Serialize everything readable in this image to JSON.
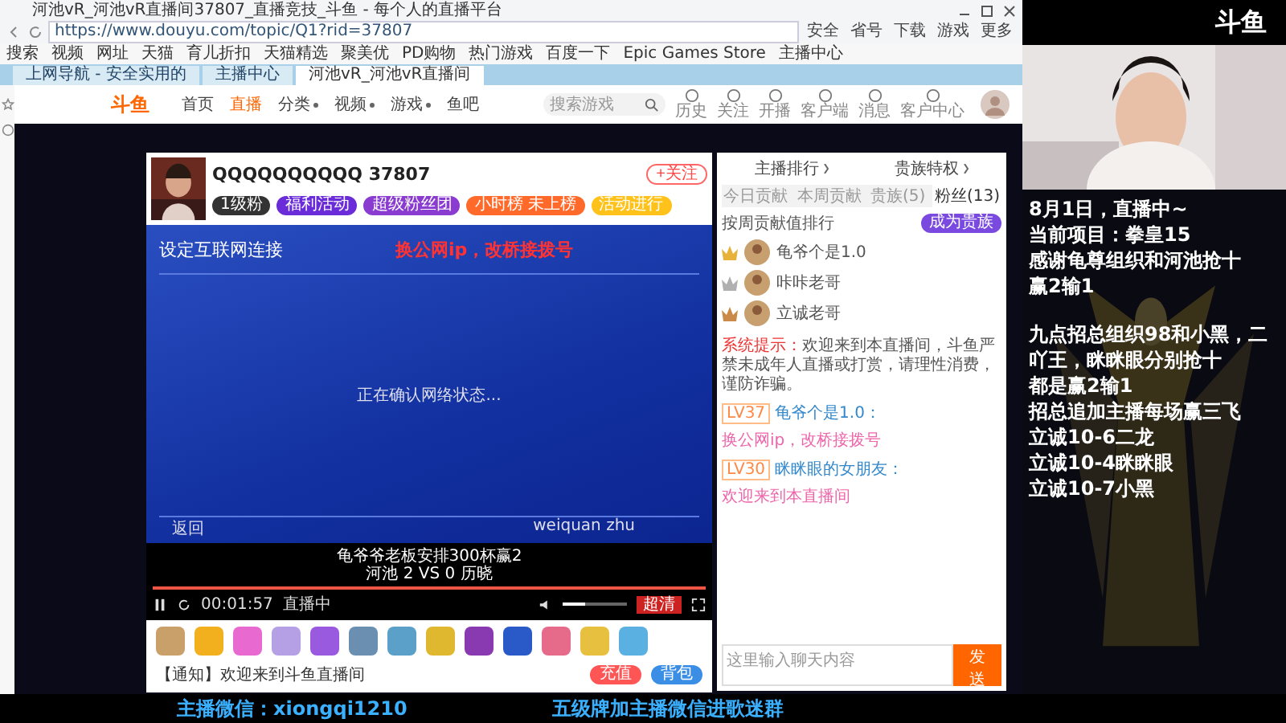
{
  "browser": {
    "title": "河池vR_河池vR直播间37807_直播竞技_斗鱼 - 每个人的直播平台",
    "url": "https://www.douyu.com/topic/Q1?rid=37807",
    "toolbar_buttons": [
      "安全",
      "省号",
      "下载",
      "游戏",
      "更多"
    ],
    "bookmarks": [
      "搜索",
      "视频",
      "网址",
      "天猫",
      "育儿折扣",
      "天猫精选",
      "聚美优",
      "PD购物",
      "热门游戏",
      "百度一下",
      "Epic Games Store",
      "主播中心"
    ],
    "tabs": [
      {
        "label": "上网导航 - 安全实用的",
        "selected": false
      },
      {
        "label": "主播中心",
        "selected": false
      },
      {
        "label": "河池vR_河池vR直播间",
        "selected": true
      }
    ]
  },
  "site_nav": {
    "logo": "斗鱼",
    "items": [
      {
        "label": "首页",
        "selected": false,
        "dropdown": false
      },
      {
        "label": "直播",
        "selected": true,
        "dropdown": false
      },
      {
        "label": "分类",
        "selected": false,
        "dropdown": true
      },
      {
        "label": "视频",
        "selected": false,
        "dropdown": true
      },
      {
        "label": "游戏",
        "selected": false,
        "dropdown": true
      },
      {
        "label": "鱼吧",
        "selected": false,
        "dropdown": false
      }
    ],
    "search_placeholder": "搜索游戏",
    "icons": [
      "历史",
      "关注",
      "开播",
      "客户端",
      "消息",
      "客户中心"
    ]
  },
  "player": {
    "room_title": "QQQQQQQQQQ 37807",
    "follow_button": "+关注",
    "tags": [
      {
        "label": "1级粉",
        "color": "#333333"
      },
      {
        "label": "福利活动",
        "color": "#6a2bd9"
      },
      {
        "label": "超级粉丝团",
        "color": "#8a3bd0"
      },
      {
        "label": "小时榜 未上榜",
        "color": "#ff6a2b"
      },
      {
        "label": "活动进行",
        "color": "#ffc21a"
      }
    ],
    "video": {
      "title": "设定互联网连接",
      "annotation": "换公网ip，改桥接拨号",
      "status": "正在确认网络状态...",
      "back_hint": "返回",
      "user": "weiquan zhu"
    },
    "subtitles": [
      "龟爷爷老板安排300杯赢2",
      "河池 2 VS 0 历晓"
    ],
    "controls": {
      "progress": {
        "level": 1.0
      },
      "time": "00:01:57",
      "live_label": "直播中",
      "volume": {
        "level": 0.35
      },
      "quality": "超清"
    },
    "gifts": [
      {
        "color": "#c9a06a"
      },
      {
        "color": "#f2b01e"
      },
      {
        "color": "#e86ad0"
      },
      {
        "color": "#b5a0e6"
      },
      {
        "color": "#9a5ae0"
      },
      {
        "color": "#6b8fb0"
      },
      {
        "color": "#5aa0c8"
      },
      {
        "color": "#e0b830"
      },
      {
        "color": "#8a3ab0"
      },
      {
        "color": "#2a5ac8"
      },
      {
        "color": "#e66a8a"
      },
      {
        "color": "#e8c040"
      },
      {
        "color": "#5ab0e0"
      }
    ],
    "notice": "【通知】欢迎来到斗鱼直播间",
    "recharge_button": "充值",
    "backpack_button": "背包"
  },
  "chat": {
    "header_links": [
      "主播排行",
      "贵族特权"
    ],
    "tabs": [
      {
        "label": "今日贡献",
        "selected": false
      },
      {
        "label": "本周贡献",
        "selected": false
      },
      {
        "label": "贵族(5)",
        "selected": false
      },
      {
        "label": "粉丝(13)",
        "selected": true
      }
    ],
    "subtitle": "按周贡献值排行",
    "join_button": "成为贵族",
    "ranking": [
      {
        "name": "龟爷个是1.0",
        "color": "#e8b23a"
      },
      {
        "name": "咔咔老哥",
        "color": "#b0b0b0"
      },
      {
        "name": "立诚老哥",
        "color": "#c98a4a"
      }
    ],
    "messages": [
      {
        "kind": "system",
        "label": "系统提示：",
        "text": "欢迎来到本直播间，斗鱼严禁未成年人直播或打赏，请理性消费，谨防诈骗。"
      },
      {
        "kind": "user",
        "level": "LV37",
        "user": "龟爷个是1.0：",
        "text": "换公网ip，改桥接拨号"
      },
      {
        "kind": "user",
        "level": "LV30",
        "user": "眯眯眼的女朋友：",
        "text": "欢迎来到本直播间"
      }
    ],
    "input_placeholder": "这里输入聊天内容",
    "send_button": "发送"
  },
  "stream_overlay": {
    "logo": "斗鱼",
    "lines": [
      "8月1日，直播中~",
      "当前项目：拳皇15",
      "感谢龟尊组织和河池抢十",
      "赢2输1",
      "九点招总组织98和小黑，二",
      "吖王，眯眯眼分别抢十",
      "都是赢2输1",
      "招总追加主播每场赢三飞",
      "立诚10-6二龙",
      "立诚10-4眯眯眼",
      "立诚10-7小黑"
    ],
    "footer": [
      "主播微信：xiongqi1210",
      "五级牌加主播微信进歌迷群"
    ]
  }
}
